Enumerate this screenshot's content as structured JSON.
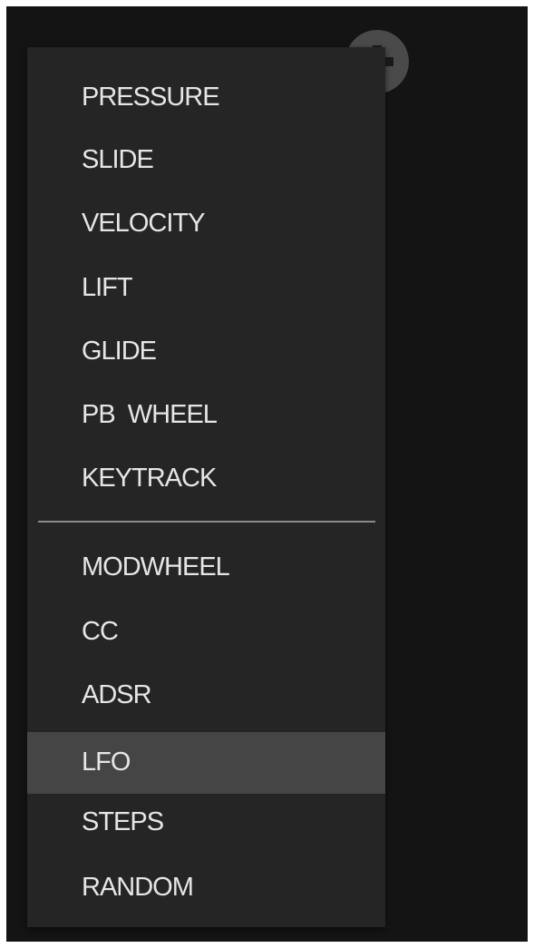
{
  "add_button": {
    "icon": "plus-icon"
  },
  "menu": {
    "items_group1": [
      {
        "label": "PRESSURE"
      },
      {
        "label": "SLIDE"
      },
      {
        "label": "VELOCITY"
      },
      {
        "label": "LIFT"
      },
      {
        "label": "GLIDE"
      },
      {
        "label": "PB  WHEEL"
      },
      {
        "label": "KEYTRACK"
      }
    ],
    "items_group2": [
      {
        "label": "MODWHEEL",
        "selected": false
      },
      {
        "label": "CC",
        "selected": false
      },
      {
        "label": "ADSR",
        "selected": false
      },
      {
        "label": "LFO",
        "selected": true
      },
      {
        "label": "STEPS",
        "selected": false
      },
      {
        "label": "RANDOM",
        "selected": false
      }
    ]
  },
  "colors": {
    "background": "#141414",
    "menu_background": "#252525",
    "selected_row": "#454545",
    "text": "#e6e6e6",
    "divider": "#8a8a8a"
  }
}
